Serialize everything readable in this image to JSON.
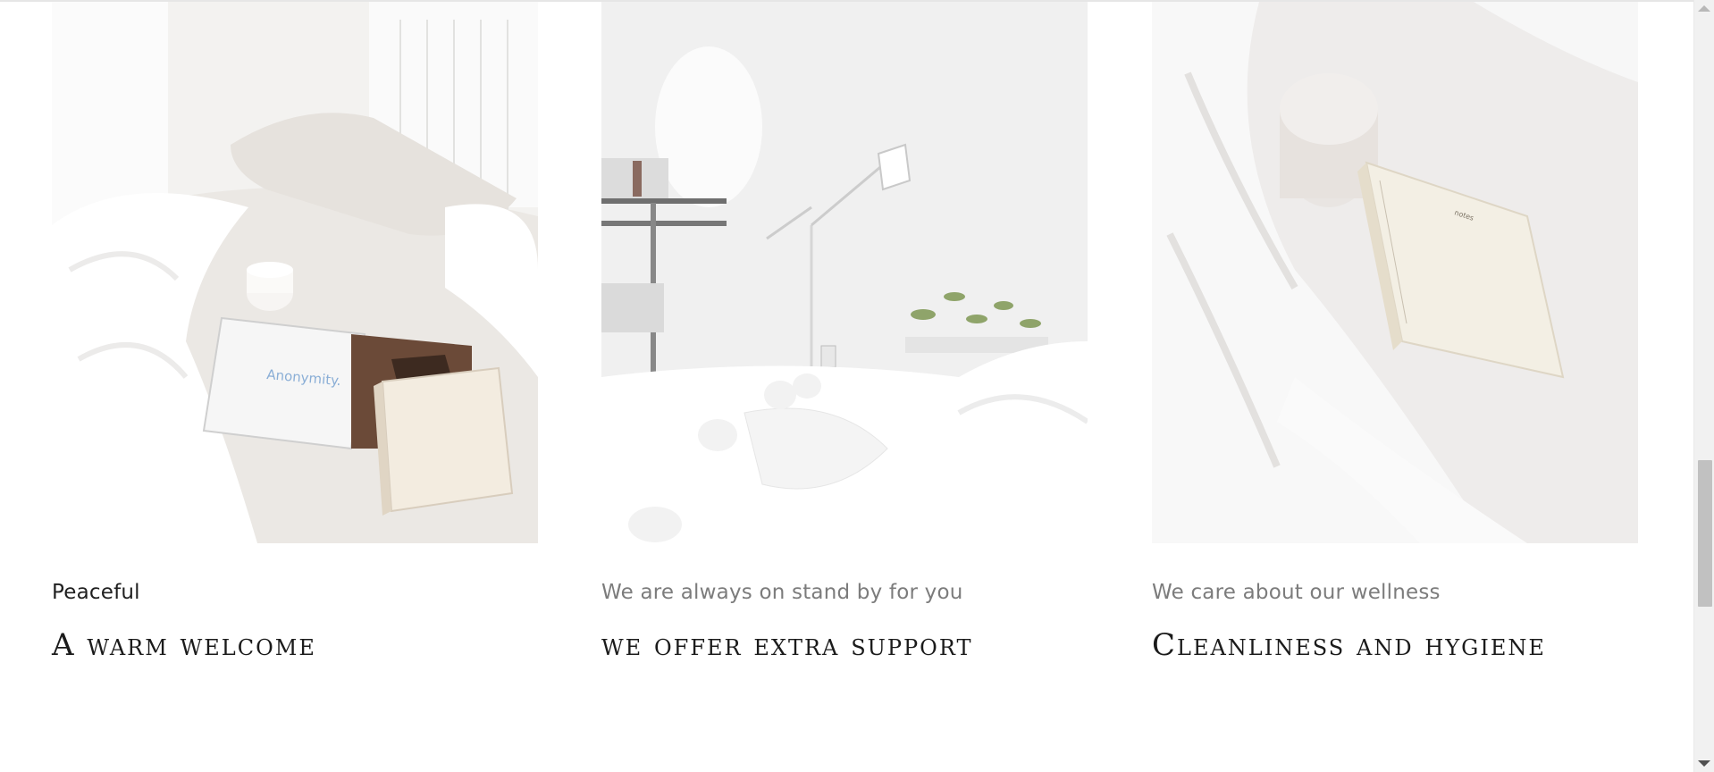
{
  "cards": [
    {
      "subtitle": "Peaceful",
      "heading": "A warm welcome",
      "photo_icon": "bed-with-magazine-icon"
    },
    {
      "subtitle": "We are always on stand by for you",
      "heading": "we offer extra support",
      "photo_icon": "bedroom-with-lamp-icon"
    },
    {
      "subtitle": "We care about our wellness",
      "heading": "Cleanliness and hygiene",
      "photo_icon": "notebook-on-bed-icon"
    }
  ]
}
